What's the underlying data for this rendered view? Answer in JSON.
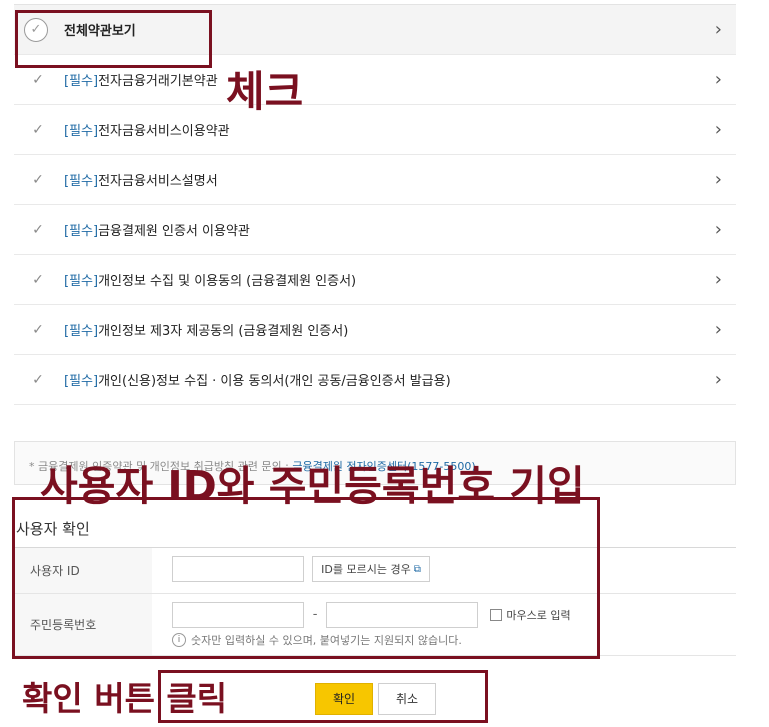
{
  "terms": {
    "all_label": "전체약관보기",
    "req_tag": "[필수]",
    "items": [
      {
        "label": "전자금융거래기본약관"
      },
      {
        "label": "전자금융서비스이용약관"
      },
      {
        "label": "전자금융서비스설명서"
      },
      {
        "label": "금융결제원 인증서 이용약관"
      },
      {
        "label": "개인정보 수집 및 이용동의 (금융결제원 인증서)"
      },
      {
        "label": "개인정보 제3자 제공동의 (금융결제원 인증서)"
      },
      {
        "label": "개인(신용)정보 수집 · 이용 동의서(개인 공동/금융인증서 발급용)"
      }
    ]
  },
  "notice": {
    "text": "* 금융결제원 인증약관 및 개인정보 취급방침 관련 문의 : ",
    "link": "금융결제원 전자인증센터(1577-5500)"
  },
  "annotations": {
    "check": "체크",
    "enter_id": "사용자 ID와 주민등록번호 기입",
    "click_confirm": "확인 버튼 클릭"
  },
  "confirm": {
    "title": "사용자 확인",
    "user_id_label": "사용자 ID",
    "forgot_id_label": "ID를 모르시는 경우",
    "rrn_label": "주민등록번호",
    "dash": "-",
    "mouse_input_label": "마우스로 입력",
    "hint": "숫자만 입력하실 수 있으며, 붙여넣기는 지원되지 않습니다."
  },
  "buttons": {
    "ok": "확인",
    "cancel": "취소"
  },
  "colors": {
    "annotation": "#7a1020",
    "primary_button": "#f7c600",
    "required_tag": "#1f6aa5"
  }
}
